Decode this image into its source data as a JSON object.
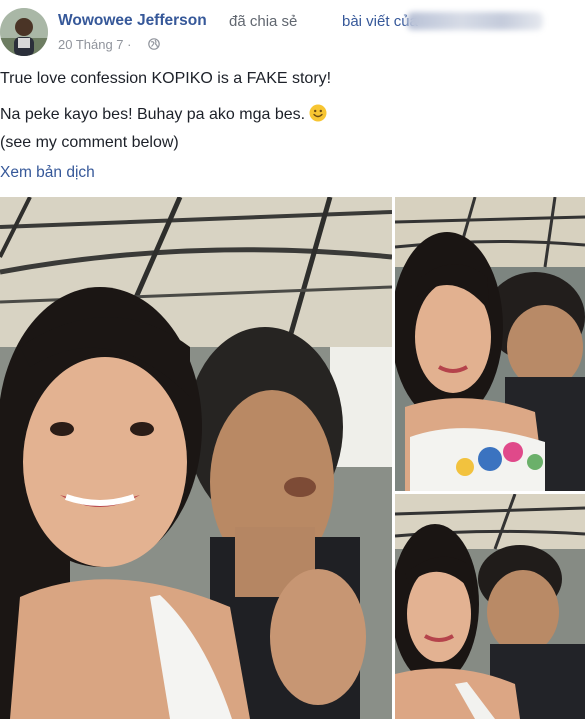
{
  "post": {
    "author": "Wowowee Jefferson",
    "shared_text": "đã chia sẻ",
    "post_link": "bài viết của",
    "date": "20 Tháng 7 ·",
    "lines": [
      "True love confession KOPIKO is a FAKE story!",
      "Na peke kayo bes! Buhay pa ako mga bes.",
      "(see my comment below)"
    ],
    "translate_label": "Xem bản dịch"
  },
  "icons": {
    "globe": "globe-icon",
    "smiley": "smiley-emoji",
    "avatar": "profile-avatar"
  },
  "colors": {
    "link": "#365899",
    "meta": "#90949c",
    "text": "#1d2129"
  }
}
